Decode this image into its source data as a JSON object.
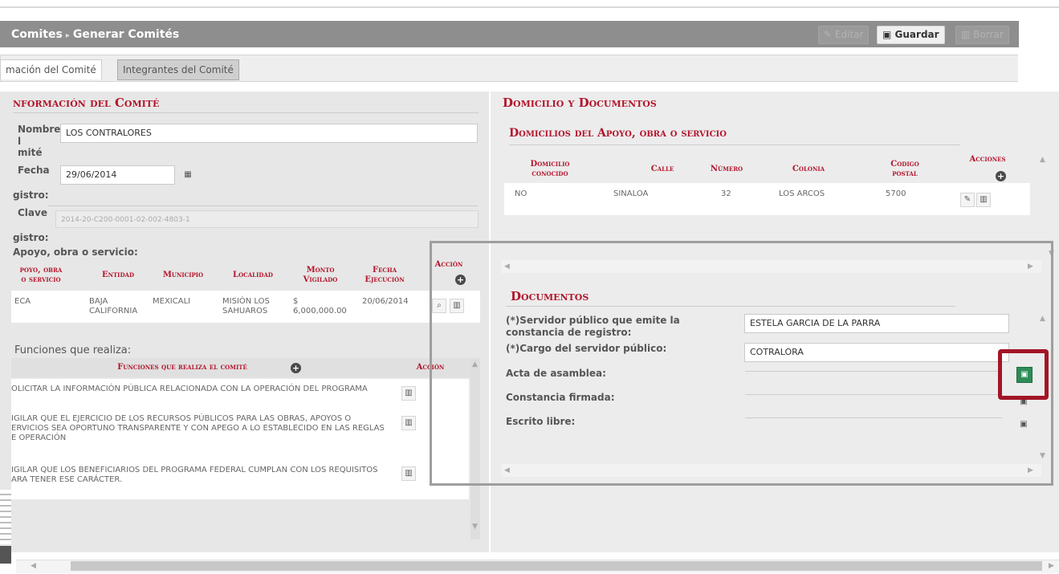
{
  "breadcrumb": {
    "parent": "Comites",
    "separator": "▸",
    "current": "Generar Comités"
  },
  "toolbar": {
    "edit_label": "Editar",
    "save_label": "Guardar",
    "delete_label": "Borrar"
  },
  "tabs": [
    {
      "label": "mación del Comité"
    },
    {
      "label": "Integrantes del Comité"
    }
  ],
  "info": {
    "title": "Información del Comité",
    "title_visible": "nformación del Comité",
    "name_label_lines": [
      "Nombre",
      "l",
      "mité"
    ],
    "name_value": "LOS CONTRALORES",
    "date_label": "Fecha",
    "date_value": "29/06/2014",
    "registro1_label": "gistro:",
    "clave_label": "Clave",
    "clave_value": "2014-20-C200-0001-02-002-4803-1",
    "registro2_label": "gistro:",
    "apoyo_label": "Apoyo, obra o servicio:"
  },
  "apoyo_table": {
    "headers": [
      "Apoyo, obra o servicio",
      "Entidad",
      "Municipio",
      "Localidad",
      "Monto Vigilado",
      "Fecha Ejecución",
      "Acción"
    ],
    "headers_visible": [
      "poyo, obra\no servicio",
      "Entidad",
      "Municipio",
      "Localidad",
      "Monto\nVigilado",
      "Fecha\nEjecución",
      "Acción"
    ],
    "rows": [
      {
        "apoyo": "ECA",
        "entidad": "BAJA CALIFORNIA",
        "municipio": "MEXICALI",
        "localidad": "MISIÓN LOS SAHUAROS",
        "monto": "$ 6,000,000.00",
        "fecha": "20/06/2014"
      }
    ]
  },
  "funciones": {
    "label": "Funciones que realiza:",
    "header": "Funciones que realiza el comité",
    "action_header": "Acción",
    "items": [
      "OLICITAR LA INFORMACIÓN PÚBLICA RELACIONADA CON LA OPERACIÓN DEL PROGRAMA",
      "IGILAR QUE EL EJERCICIO DE LOS RECURSOS PÚBLICOS PARA LAS OBRAS, APOYOS O ERVICIOS SEA OPORTUNO TRANSPARENTE Y CON APEGO A LO ESTABLECIDO EN LAS REGLAS E OPERACIÓN",
      "IGILAR QUE LOS BENEFICIARIOS DEL PROGRAMA FEDERAL CUMPLAN CON LOS REQUISITOS ARA TENER ESE CARÁCTER."
    ]
  },
  "domicilio": {
    "section_title": "Domicilio y Documentos",
    "subtitle": "Domicilios del Apoyo, obra o servicio",
    "headers": [
      "Domicilio conocido",
      "Calle",
      "Número",
      "Colonia",
      "Codigo postal",
      "Acciones"
    ],
    "rows": [
      {
        "conocido": "NO",
        "calle": "SINALOA",
        "numero": "32",
        "colonia": "LOS ARCOS",
        "cp": "5700"
      }
    ]
  },
  "documentos": {
    "title": "Documentos",
    "servidor_label": "(*)Servidor público que emite la constancia de registro:",
    "servidor_value": "ESTELA GARCIA DE LA PARRA",
    "cargo_label": "(*)Cargo del servidor público:",
    "cargo_value": "COTRALORA",
    "acta_label": "Acta de asamblea:",
    "constancia_label": "Constancia firmada:",
    "escrito_label": "Escrito libre:"
  },
  "icons": {
    "save": "save-icon",
    "edit": "pencil-icon",
    "delete": "trash-icon",
    "search": "magnifier-icon",
    "add": "plus-circle-icon",
    "calendar": "calendar-icon"
  },
  "colors": {
    "accent_red": "#b3162c",
    "highlight_red": "#a31526",
    "save_green": "#2e8b57",
    "header_gray": "#8e8e8e"
  }
}
